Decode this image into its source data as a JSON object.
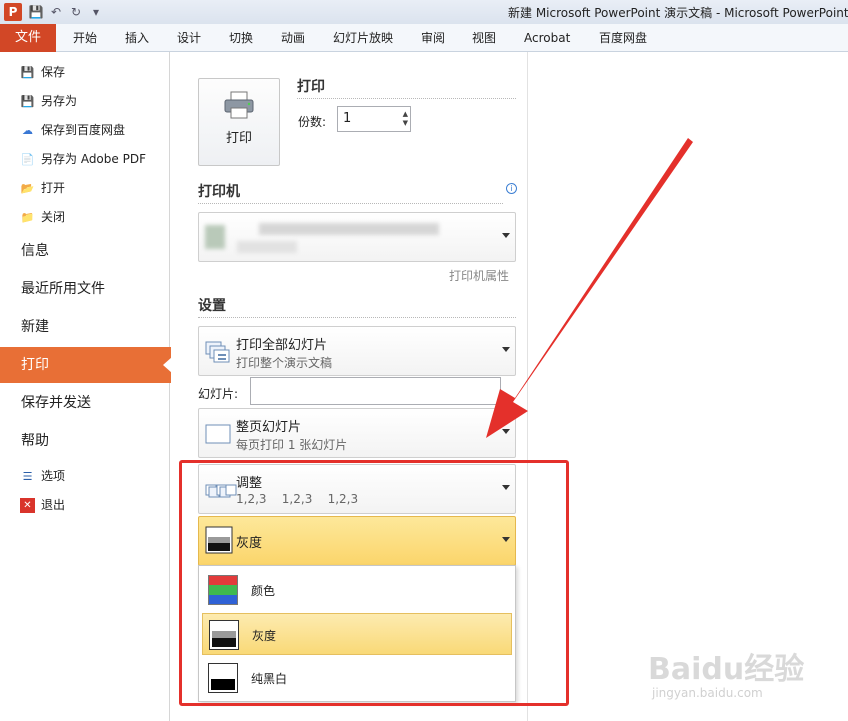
{
  "window": {
    "app_icon": "P",
    "title": "新建 Microsoft PowerPoint 演示文稿 - Microsoft PowerPoint"
  },
  "ribbon": {
    "file_tab": "文件",
    "tabs": [
      "开始",
      "插入",
      "设计",
      "切换",
      "动画",
      "幻灯片放映",
      "审阅",
      "视图",
      "Acrobat",
      "百度网盘"
    ]
  },
  "nav": {
    "small_top": [
      "保存",
      "另存为",
      "保存到百度网盘",
      "另存为 Adobe PDF",
      "打开",
      "关闭"
    ],
    "big": [
      "信息",
      "最近所用文件",
      "新建",
      "打印",
      "保存并发送",
      "帮助"
    ],
    "active": "打印",
    "small_bottom": [
      "选项",
      "退出"
    ]
  },
  "print": {
    "button_label": "打印",
    "heading": "打印",
    "copies_label": "份数:",
    "copies_value": "1"
  },
  "printer": {
    "heading": "打印机",
    "properties_link": "打印机属性"
  },
  "settings": {
    "heading": "设置",
    "range": {
      "title": "打印全部幻灯片",
      "subtitle": "打印整个演示文稿"
    },
    "slides_label": "幻灯片:",
    "layout": {
      "title": "整页幻灯片",
      "subtitle": "每页打印 1 张幻灯片"
    },
    "collate": {
      "title": "调整",
      "subtitle": "1,2,3    1,2,3    1,2,3"
    },
    "color": {
      "title": "灰度"
    },
    "color_options": [
      "颜色",
      "灰度",
      "纯黑白"
    ],
    "color_selected": "灰度"
  },
  "watermark": {
    "brand": "Baidu经验",
    "url": "jingyan.baidu.com"
  },
  "colors": {
    "file_tab": "#d24726",
    "active_nav": "#e86f36",
    "highlight": "#fbd56b",
    "annotation_red": "#e4302b"
  }
}
